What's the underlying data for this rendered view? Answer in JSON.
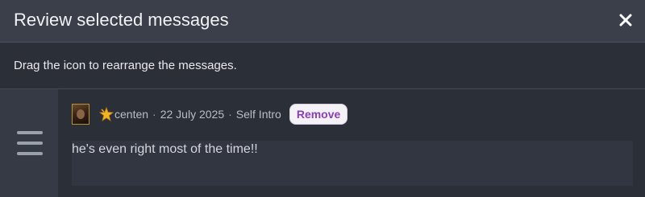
{
  "dialog": {
    "title": "Review selected messages",
    "close_icon": "close-icon"
  },
  "instructions": {
    "text": "Drag the icon to rearrange the messages."
  },
  "message": {
    "drag_icon": "hamburger-drag-icon",
    "author": "centen",
    "date": "22 July 2025",
    "thread": "Self Intro",
    "separator": "·",
    "remove_label": "Remove",
    "body": "he's even right most of the time!!"
  },
  "colors": {
    "remove_text": "#8a3fb5",
    "header_bg": "#3a3f4a",
    "body_bg": "#2b2f38"
  }
}
